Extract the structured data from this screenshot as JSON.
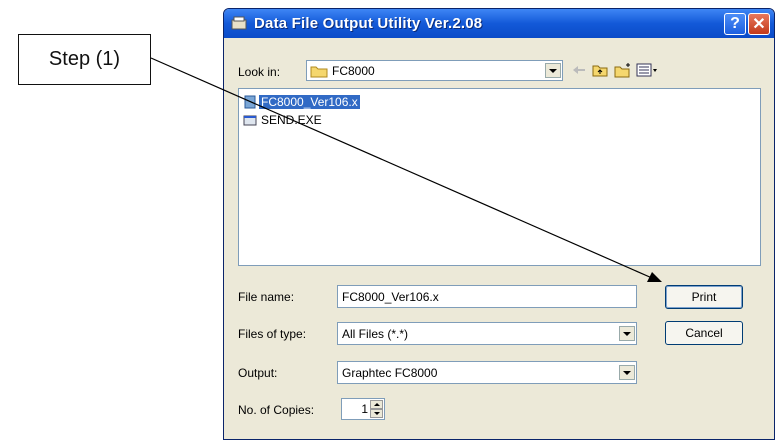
{
  "callout": {
    "label": "Step (1)"
  },
  "dialog": {
    "title": "Data File Output Utility Ver.2.08",
    "help_label": "?",
    "close_label": "✕",
    "look_in_label": "Look in:",
    "look_in_value": "FC8000",
    "files": [
      {
        "name": "FC8000_Ver106.x",
        "selected": true,
        "icon": "file-icon"
      },
      {
        "name": "SEND.EXE",
        "selected": false,
        "icon": "exe-icon"
      }
    ],
    "file_name_label": "File name:",
    "file_name_value": "FC8000_Ver106.x",
    "files_of_type_label": "Files of type:",
    "files_of_type_value": "All Files (*.*)",
    "output_label": "Output:",
    "output_value": "Graphtec FC8000",
    "copies_label": "No. of Copies:",
    "copies_value": "1",
    "print_label": "Print",
    "cancel_label": "Cancel"
  },
  "colors": {
    "titlebar": "#1359d8",
    "selection": "#316ac5",
    "dialog_bg": "#ece9d8"
  }
}
